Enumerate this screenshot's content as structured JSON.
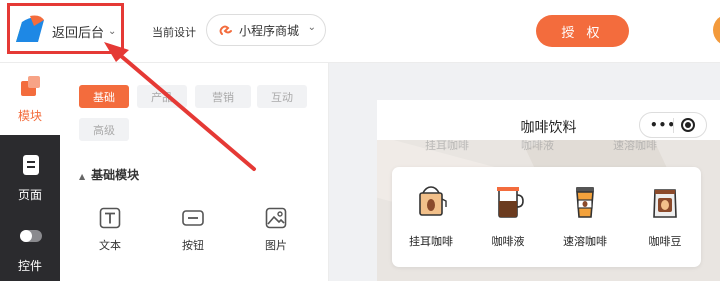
{
  "header": {
    "back_label": "返回后台",
    "current_design_label": "当前设计",
    "design_select_value": "小程序商城",
    "authorize_button": "授 权"
  },
  "sidebar_nav": [
    {
      "label": "模块",
      "icon": "modules-icon",
      "active": true
    },
    {
      "label": "页面",
      "icon": "page-icon",
      "active": false
    },
    {
      "label": "控件",
      "icon": "toggle-icon",
      "active": false
    }
  ],
  "component_panel": {
    "tabs": [
      "基础",
      "产品",
      "营销",
      "互动",
      "高级"
    ],
    "active_tab": "基础",
    "section_title": "基础模块",
    "components": [
      {
        "label": "文本",
        "icon": "text-icon"
      },
      {
        "label": "按钮",
        "icon": "button-icon"
      },
      {
        "label": "图片",
        "icon": "image-icon"
      }
    ]
  },
  "preview": {
    "title": "咖啡饮料",
    "banner_partial_text": [
      "挂耳咖啡",
      "咖啡液",
      "速溶咖啡"
    ],
    "categories": [
      {
        "label": "挂耳咖啡",
        "icon": "drip-bag-icon"
      },
      {
        "label": "咖啡液",
        "icon": "coffee-pot-icon"
      },
      {
        "label": "速溶咖啡",
        "icon": "coffee-cup-icon"
      },
      {
        "label": "咖啡豆",
        "icon": "coffee-bean-bag-icon"
      }
    ]
  },
  "colors": {
    "accent": "#f36c3d",
    "nav_bg": "#2b2b2e",
    "annotation_red": "#e53935",
    "canvas_bg": "#f0f1f3"
  }
}
